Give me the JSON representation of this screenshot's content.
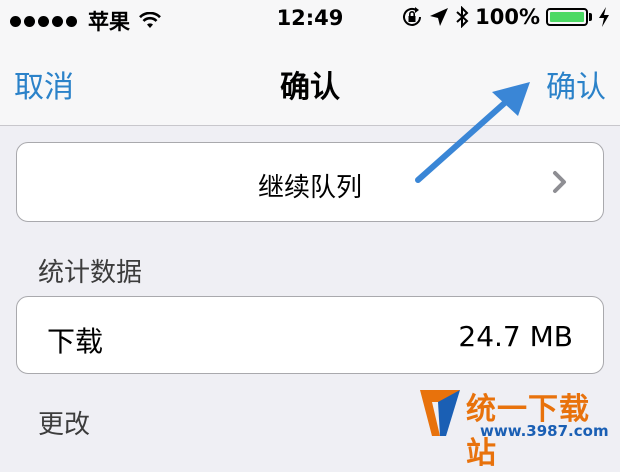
{
  "status_bar": {
    "signal_dots": 5,
    "carrier": "苹果",
    "time": "12:49",
    "battery_text": "100%",
    "battery_level": 1.0,
    "icons": [
      "wifi-icon",
      "rotation-lock-icon",
      "location-arrow-icon",
      "bluetooth-icon",
      "charging-bolt-icon"
    ]
  },
  "nav": {
    "cancel": "取消",
    "title": "确认",
    "confirm": "确认"
  },
  "queue": {
    "label": "继续队列",
    "chevron_icon": "chevron-right-icon"
  },
  "stats": {
    "header": "统计数据",
    "download_label": "下载",
    "download_value": "24.7 MB"
  },
  "changes": {
    "header": "更改"
  },
  "watermark": {
    "text": "统一下载站",
    "url": "www.3987.com"
  },
  "colors": {
    "accent": "#2b82c9",
    "arrow": "#3a86d6",
    "battery_green": "#4cd964",
    "watermark_orange": "#e8720c"
  }
}
